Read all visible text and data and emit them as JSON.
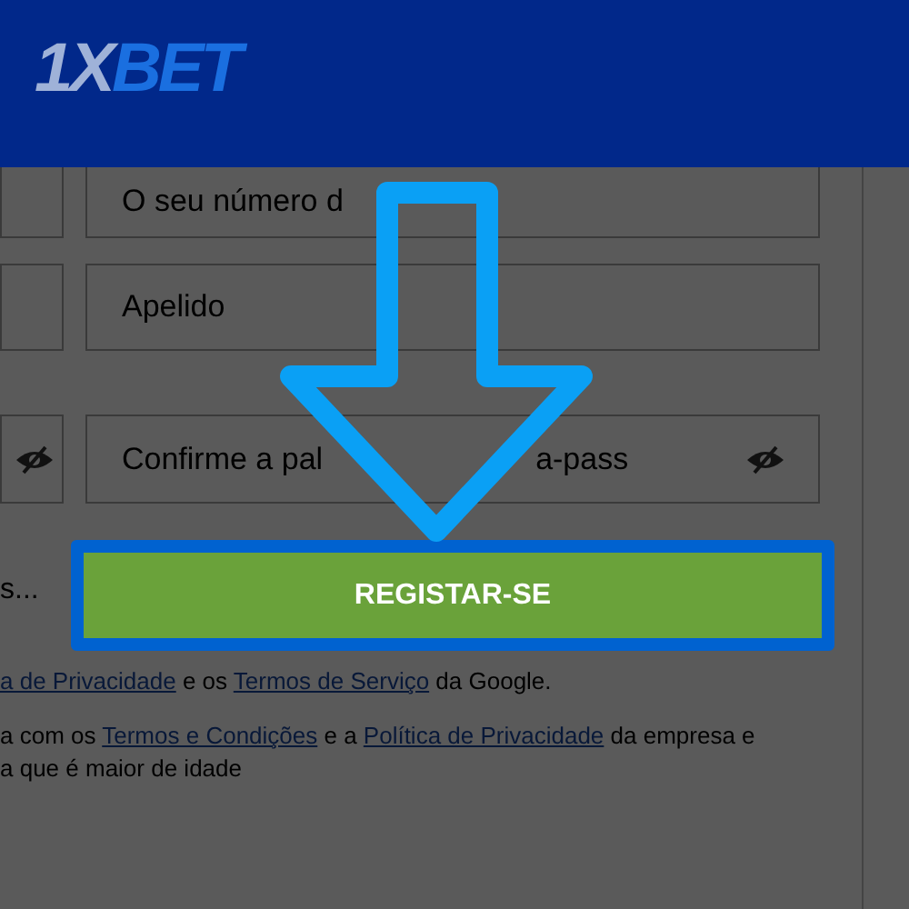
{
  "header": {
    "logo": {
      "part_1": "1X",
      "part_2": "BET"
    }
  },
  "form": {
    "rows": [
      {
        "left": {
          "eye_toggle": false
        },
        "right": {
          "placeholder": "O seu número d",
          "eye_toggle": false
        }
      },
      {
        "left": {
          "eye_toggle": false
        },
        "right": {
          "placeholder": "Apelido",
          "eye_toggle": false
        }
      },
      {
        "left": {
          "eye_toggle": true
        },
        "right": {
          "placeholder": "Confirme a pal",
          "placeholder_after_arrow": "a-pass",
          "eye_toggle": true
        }
      }
    ],
    "submit_row": {
      "left_text": "s...",
      "button": {
        "label": "REGISTAR-SE",
        "highlighted": true
      }
    }
  },
  "notes": [
    {
      "lines": [
        [
          {
            "text": "a de Privacidade",
            "link": true
          },
          {
            "text": " e os ",
            "link": false
          },
          {
            "text": "Termos de Serviço",
            "link": true
          },
          {
            "text": " da Google.",
            "link": false
          }
        ]
      ]
    },
    {
      "lines": [
        [
          {
            "text": "a com os ",
            "link": false
          },
          {
            "text": "Termos e Condições",
            "link": true
          },
          {
            "text": " e a ",
            "link": false
          },
          {
            "text": "Política de Privacidade",
            "link": true
          },
          {
            "text": " da empresa e",
            "link": false
          }
        ],
        [
          {
            "text": "a que é maior de idade",
            "link": false
          }
        ]
      ]
    }
  ]
}
